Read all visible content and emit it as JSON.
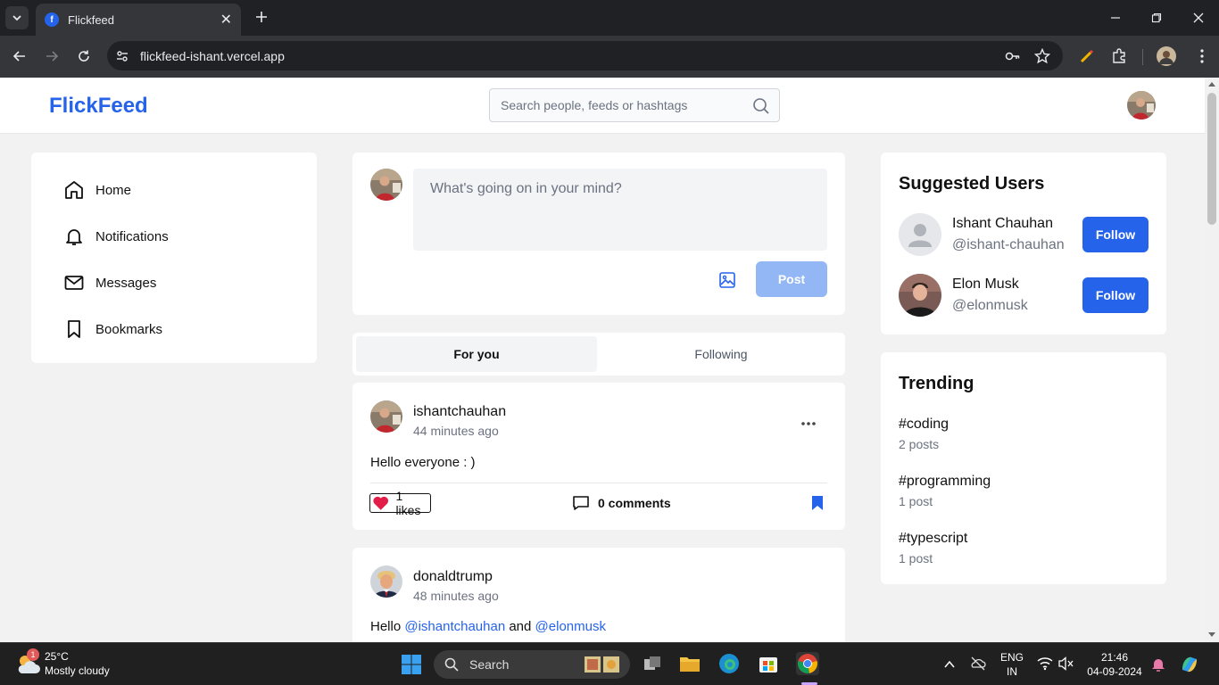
{
  "browser": {
    "tab_title": "Flickfeed",
    "favicon_letter": "f",
    "url": "flickfeed-ishant.vercel.app"
  },
  "app": {
    "logo": "FlickFeed",
    "search_placeholder": "Search people, feeds or hashtags"
  },
  "sidebar": {
    "items": [
      {
        "label": "Home",
        "icon": "home-icon"
      },
      {
        "label": "Notifications",
        "icon": "bell-icon"
      },
      {
        "label": "Messages",
        "icon": "mail-icon"
      },
      {
        "label": "Bookmarks",
        "icon": "bookmark-icon"
      }
    ]
  },
  "composer": {
    "placeholder": "What's going on in your mind?",
    "post_label": "Post"
  },
  "feed_tabs": {
    "for_you": "For you",
    "following": "Following",
    "active": "For you"
  },
  "posts": [
    {
      "username": "ishantchauhan",
      "time": "44 minutes ago",
      "text": "Hello everyone : )",
      "likes": "1 likes",
      "comments": "0 comments",
      "liked": true,
      "bookmarked": true
    },
    {
      "username": "donaldtrump",
      "time": "48 minutes ago",
      "text_prefix": "Hello ",
      "mention1": "@ishantchauhan",
      "text_mid": " and ",
      "mention2": "@elonmusk"
    }
  ],
  "suggested": {
    "title": "Suggested Users",
    "users": [
      {
        "name": "Ishant Chauhan",
        "handle": "@ishant-chauhan",
        "follow_label": "Follow"
      },
      {
        "name": "Elon Musk",
        "handle": "@elonmusk",
        "follow_label": "Follow"
      }
    ]
  },
  "trending": {
    "title": "Trending",
    "items": [
      {
        "tag": "#coding",
        "count": "2 posts"
      },
      {
        "tag": "#programming",
        "count": "1 post"
      },
      {
        "tag": "#typescript",
        "count": "1 post"
      }
    ]
  },
  "taskbar": {
    "weather_temp": "25°C",
    "weather_desc": "Mostly cloudy",
    "weather_badge": "1",
    "search_label": "Search",
    "lang_top": "ENG",
    "lang_bottom": "IN",
    "time": "21:46",
    "date": "04-09-2024"
  },
  "colors": {
    "brand": "#2563eb",
    "post_disabled": "#93b7f5",
    "like": "#e11d48"
  }
}
